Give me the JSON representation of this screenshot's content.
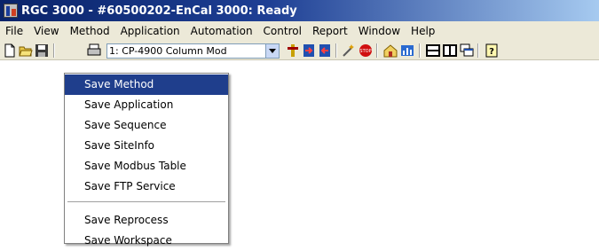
{
  "window": {
    "title": "RGC 3000  - #60500202-EnCal 3000: Ready"
  },
  "menubar": [
    "File",
    "View",
    "Method",
    "Application",
    "Automation",
    "Control",
    "Report",
    "Window",
    "Help"
  ],
  "toolbar": {
    "combo_value": "1: CP-4900 Column Mod",
    "icons": [
      "new-icon",
      "open-icon",
      "save-icon",
      "print-icon",
      "tool-icon-1",
      "tool-icon-2",
      "tool-icon-3",
      "wand-icon",
      "stop-icon",
      "chart-icon-1",
      "chart-icon-2",
      "layout-icon-1",
      "layout-icon-2",
      "layout-icon-3",
      "help-icon"
    ]
  },
  "save_menu": {
    "group1": [
      "Save Method",
      "Save Application",
      "Save Sequence",
      "Save SiteInfo",
      "Save Modbus Table",
      "Save FTP Service"
    ],
    "group2": [
      "Save Reprocess",
      "Save Workspace"
    ],
    "highlighted": "Save Method"
  }
}
